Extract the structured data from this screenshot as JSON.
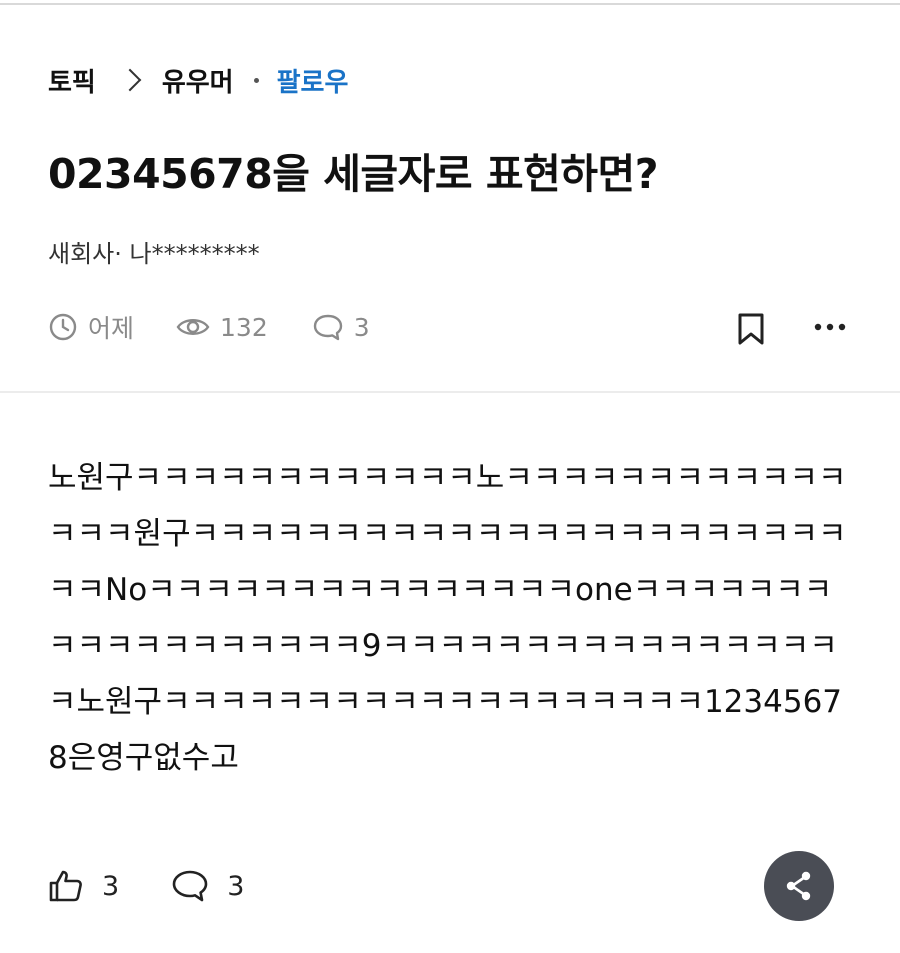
{
  "breadcrumb": {
    "topic": "토픽",
    "category": "유우머",
    "follow": "팔로우"
  },
  "post": {
    "title": "02345678을 세글자로 표현하면?",
    "author": "새회사· 나*********",
    "time": "어제",
    "views": "132",
    "comments": "3",
    "body": "노원구ㅋㅋㅋㅋㅋㅋㅋㅋㅋㅋㅋㅋ노ㅋㅋㅋㅋㅋㅋㅋㅋㅋㅋㅋㅋㅋㅋㅋ원구ㅋㅋㅋㅋㅋㅋㅋㅋㅋㅋㅋㅋㅋㅋㅋㅋㅋㅋㅋㅋㅋㅋㅋㅋㅋNoㅋㅋㅋㅋㅋㅋㅋㅋㅋㅋㅋㅋㅋㅋㅋoneㅋㅋㅋㅋㅋㅋㅋㅋㅋㅋㅋㅋㅋㅋㅋㅋㅋㅋ9ㅋㅋㅋㅋㅋㅋㅋㅋㅋㅋㅋㅋㅋㅋㅋㅋㅋ노원구ㅋㅋㅋㅋㅋㅋㅋㅋㅋㅋㅋㅋㅋㅋㅋㅋㅋㅋㅋ12345678은영구없수고"
  },
  "footer": {
    "likes": "3",
    "comments": "3"
  },
  "icons": {
    "clock": "clock-icon",
    "eye": "eye-icon",
    "comment": "comment-icon",
    "bookmark": "bookmark-icon",
    "more": "more-icon",
    "like": "thumbs-up-icon",
    "share": "share-icon"
  },
  "colors": {
    "follow": "#1a73c7",
    "meta": "#8a8a8a",
    "fab": "#4a4d55"
  }
}
